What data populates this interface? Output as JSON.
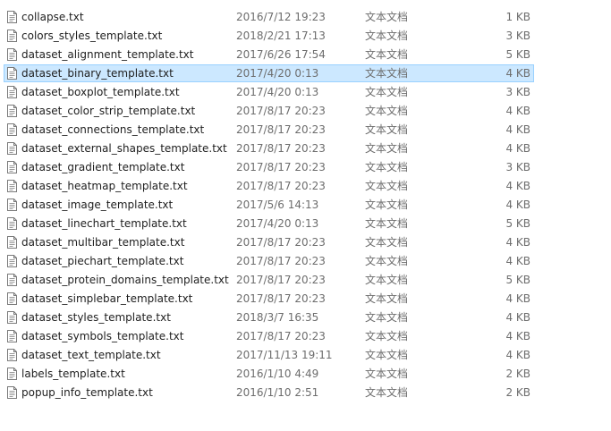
{
  "icon": "text-file-icon",
  "files": [
    {
      "name": "collapse.txt",
      "date": "2016/7/12 19:23",
      "type": "文本文档",
      "size": "1 KB"
    },
    {
      "name": "colors_styles_template.txt",
      "date": "2018/2/21 17:13",
      "type": "文本文档",
      "size": "3 KB"
    },
    {
      "name": "dataset_alignment_template.txt",
      "date": "2017/6/26 17:54",
      "type": "文本文档",
      "size": "5 KB"
    },
    {
      "name": "dataset_binary_template.txt",
      "date": "2017/4/20 0:13",
      "type": "文本文档",
      "size": "4 KB",
      "selected": true
    },
    {
      "name": "dataset_boxplot_template.txt",
      "date": "2017/4/20 0:13",
      "type": "文本文档",
      "size": "3 KB"
    },
    {
      "name": "dataset_color_strip_template.txt",
      "date": "2017/8/17 20:23",
      "type": "文本文档",
      "size": "4 KB"
    },
    {
      "name": "dataset_connections_template.txt",
      "date": "2017/8/17 20:23",
      "type": "文本文档",
      "size": "4 KB"
    },
    {
      "name": "dataset_external_shapes_template.txt",
      "date": "2017/8/17 20:23",
      "type": "文本文档",
      "size": "4 KB"
    },
    {
      "name": "dataset_gradient_template.txt",
      "date": "2017/8/17 20:23",
      "type": "文本文档",
      "size": "3 KB"
    },
    {
      "name": "dataset_heatmap_template.txt",
      "date": "2017/8/17 20:23",
      "type": "文本文档",
      "size": "4 KB"
    },
    {
      "name": "dataset_image_template.txt",
      "date": "2017/5/6 14:13",
      "type": "文本文档",
      "size": "4 KB"
    },
    {
      "name": "dataset_linechart_template.txt",
      "date": "2017/4/20 0:13",
      "type": "文本文档",
      "size": "5 KB"
    },
    {
      "name": "dataset_multibar_template.txt",
      "date": "2017/8/17 20:23",
      "type": "文本文档",
      "size": "4 KB"
    },
    {
      "name": "dataset_piechart_template.txt",
      "date": "2017/8/17 20:23",
      "type": "文本文档",
      "size": "4 KB"
    },
    {
      "name": "dataset_protein_domains_template.txt",
      "date": "2017/8/17 20:23",
      "type": "文本文档",
      "size": "5 KB"
    },
    {
      "name": "dataset_simplebar_template.txt",
      "date": "2017/8/17 20:23",
      "type": "文本文档",
      "size": "4 KB"
    },
    {
      "name": "dataset_styles_template.txt",
      "date": "2018/3/7 16:35",
      "type": "文本文档",
      "size": "4 KB"
    },
    {
      "name": "dataset_symbols_template.txt",
      "date": "2017/8/17 20:23",
      "type": "文本文档",
      "size": "4 KB"
    },
    {
      "name": "dataset_text_template.txt",
      "date": "2017/11/13 19:11",
      "type": "文本文档",
      "size": "4 KB"
    },
    {
      "name": "labels_template.txt",
      "date": "2016/1/10 4:49",
      "type": "文本文档",
      "size": "2 KB"
    },
    {
      "name": "popup_info_template.txt",
      "date": "2016/1/10 2:51",
      "type": "文本文档",
      "size": "2 KB"
    }
  ]
}
